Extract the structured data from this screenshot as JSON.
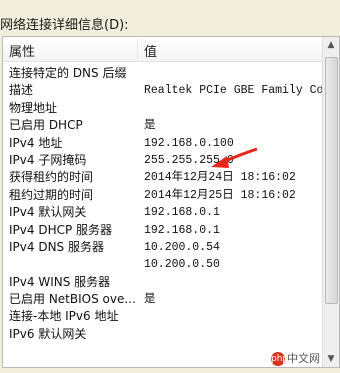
{
  "dialog_title": "网络连接详细信息(D):",
  "table": {
    "header": {
      "property": "属性",
      "value": "值"
    },
    "rows": [
      {
        "property": "连接特定的 DNS 后缀",
        "value": ""
      },
      {
        "property": "描述",
        "value": "Realtek PCIe GBE Family Controller"
      },
      {
        "property": "物理地址",
        "value": ""
      },
      {
        "property": "已启用 DHCP",
        "value": "是"
      },
      {
        "property": "IPv4 地址",
        "value": "192.168.0.100"
      },
      {
        "property": "IPv4 子网掩码",
        "value": "255.255.255.0"
      },
      {
        "property": "获得租约的时间",
        "value": "2014年12月24日 18:16:02"
      },
      {
        "property": "租约过期的时间",
        "value": "2014年12月25日 18:16:02"
      },
      {
        "property": "IPv4 默认网关",
        "value": "192.168.0.1"
      },
      {
        "property": "IPv4 DHCP 服务器",
        "value": "192.168.0.1"
      },
      {
        "property": "IPv4 DNS 服务器",
        "value": "10.200.0.54"
      },
      {
        "property": "",
        "value": "10.200.0.50"
      },
      {
        "property": "IPv4 WINS 服务器",
        "value": ""
      },
      {
        "property": "已启用 NetBIOS ove...",
        "value": "是"
      },
      {
        "property": "连接-本地 IPv6 地址",
        "value": ""
      },
      {
        "property": "IPv6 默认网关",
        "value": ""
      }
    ]
  },
  "watermark": {
    "logo_text": "php",
    "text": "中文网"
  },
  "colors": {
    "annotation_arrow": "#e8231a",
    "background": "#f2eede"
  }
}
